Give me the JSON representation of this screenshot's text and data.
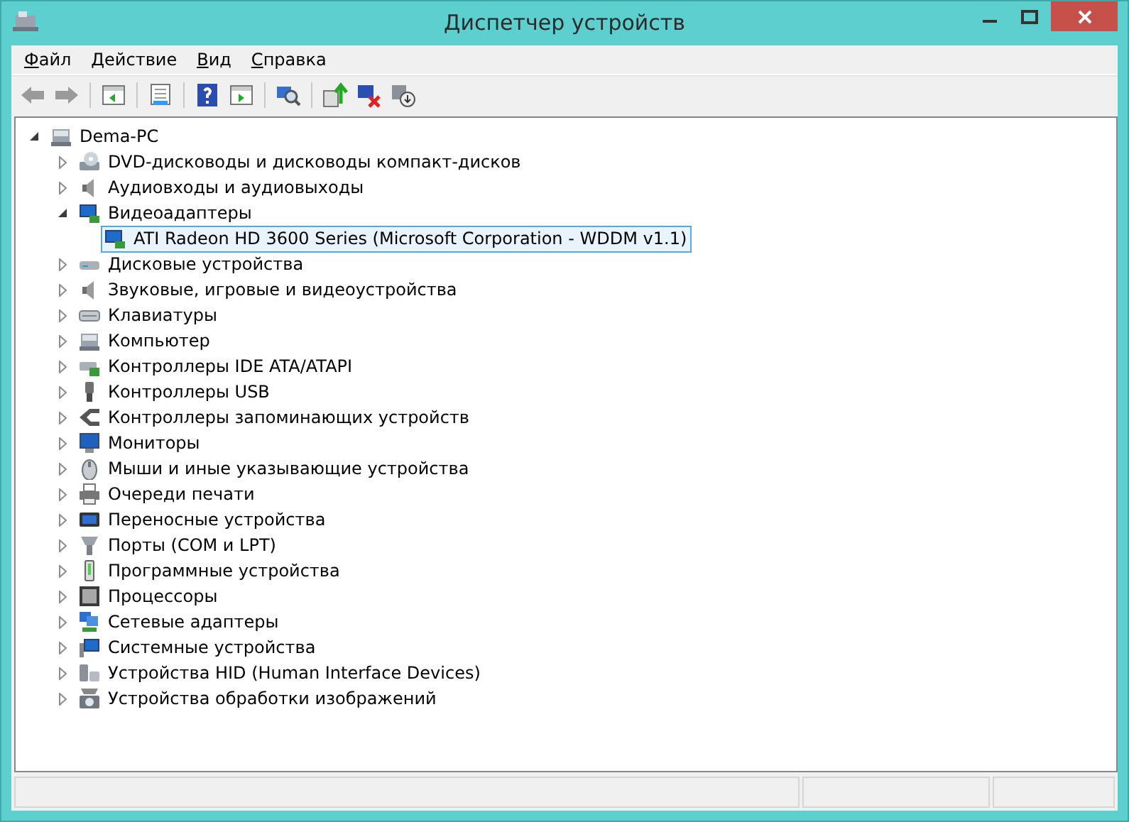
{
  "window": {
    "title": "Диспетчер устройств"
  },
  "menu": [
    "Файл",
    "Действие",
    "Вид",
    "Справка"
  ],
  "tree": {
    "label": "Dema-PC",
    "expanded": true,
    "children": [
      {
        "label": "DVD-дисководы и дисководы компакт-дисков",
        "expanded": false
      },
      {
        "label": "Аудиовходы и аудиовыходы",
        "expanded": false
      },
      {
        "label": "Видеоадаптеры",
        "expanded": true,
        "children": [
          {
            "label": "ATI Radeon HD 3600 Series (Microsoft Corporation - WDDM v1.1)",
            "selected": true
          }
        ]
      },
      {
        "label": "Дисковые устройства",
        "expanded": false
      },
      {
        "label": "Звуковые, игровые и видеоустройства",
        "expanded": false
      },
      {
        "label": "Клавиатуры",
        "expanded": false
      },
      {
        "label": "Компьютер",
        "expanded": false
      },
      {
        "label": "Контроллеры IDE ATA/ATAPI",
        "expanded": false
      },
      {
        "label": "Контроллеры USB",
        "expanded": false
      },
      {
        "label": "Контроллеры запоминающих устройств",
        "expanded": false
      },
      {
        "label": "Мониторы",
        "expanded": false
      },
      {
        "label": "Мыши и иные указывающие устройства",
        "expanded": false
      },
      {
        "label": "Очереди печати",
        "expanded": false
      },
      {
        "label": "Переносные устройства",
        "expanded": false
      },
      {
        "label": "Порты (COM и LPT)",
        "expanded": false
      },
      {
        "label": "Программные устройства",
        "expanded": false
      },
      {
        "label": "Процессоры",
        "expanded": false
      },
      {
        "label": "Сетевые адаптеры",
        "expanded": false
      },
      {
        "label": "Системные устройства",
        "expanded": false
      },
      {
        "label": "Устройства HID (Human Interface Devices)",
        "expanded": false
      },
      {
        "label": "Устройства обработки изображений",
        "expanded": false
      }
    ]
  }
}
